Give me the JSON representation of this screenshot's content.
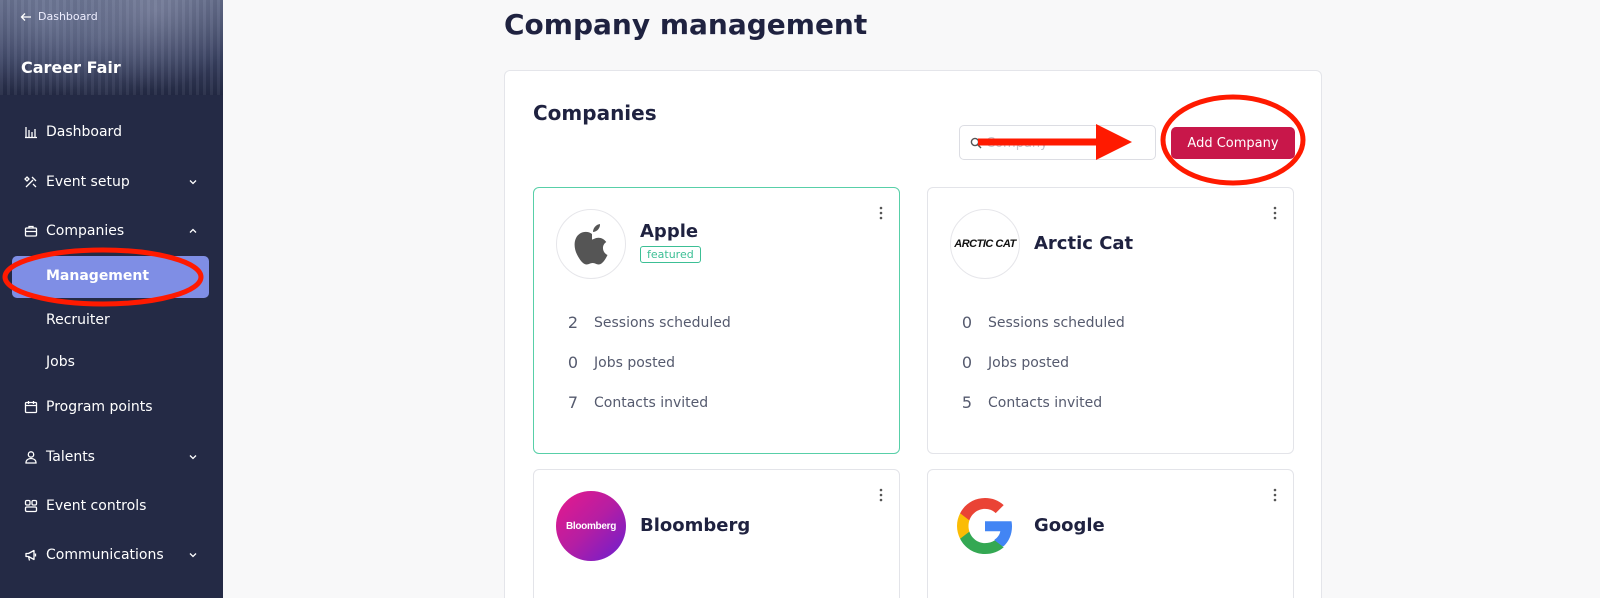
{
  "sidebar": {
    "back_label": "Dashboard",
    "app_title": "Career Fair",
    "items": [
      {
        "label": "Dashboard"
      },
      {
        "label": "Event setup"
      },
      {
        "label": "Companies"
      },
      {
        "label": "Program points"
      },
      {
        "label": "Talents"
      },
      {
        "label": "Event controls"
      },
      {
        "label": "Communications"
      }
    ],
    "companies_sub": [
      {
        "label": "Management",
        "active": true
      },
      {
        "label": "Recruiter"
      },
      {
        "label": "Jobs"
      }
    ]
  },
  "main": {
    "page_title": "Company management",
    "panel_title": "Companies",
    "search_placeholder": "Company",
    "add_button": "Add Company",
    "cards": [
      {
        "name": "Apple",
        "badge": "featured",
        "logo": "apple-logo",
        "stats": [
          {
            "num": "2",
            "label": "Sessions scheduled"
          },
          {
            "num": "0",
            "label": "Jobs posted"
          },
          {
            "num": "7",
            "label": "Contacts invited"
          }
        ]
      },
      {
        "name": "Arctic Cat",
        "logo": "arctic-cat-logo",
        "logo_text": "ARCTIC CAT",
        "stats": [
          {
            "num": "0",
            "label": "Sessions scheduled"
          },
          {
            "num": "0",
            "label": "Jobs posted"
          },
          {
            "num": "5",
            "label": "Contacts invited"
          }
        ]
      },
      {
        "name": "Bloomberg",
        "logo": "bloomberg-logo",
        "logo_text": "Bloomberg"
      },
      {
        "name": "Google",
        "logo": "google-logo"
      }
    ]
  },
  "colors": {
    "sidebar_bg": "#242a45",
    "active_item": "#7f8ee5",
    "accent_button": "#c8174a",
    "featured": "#3cbf95",
    "annotation": "#ff1a00"
  }
}
